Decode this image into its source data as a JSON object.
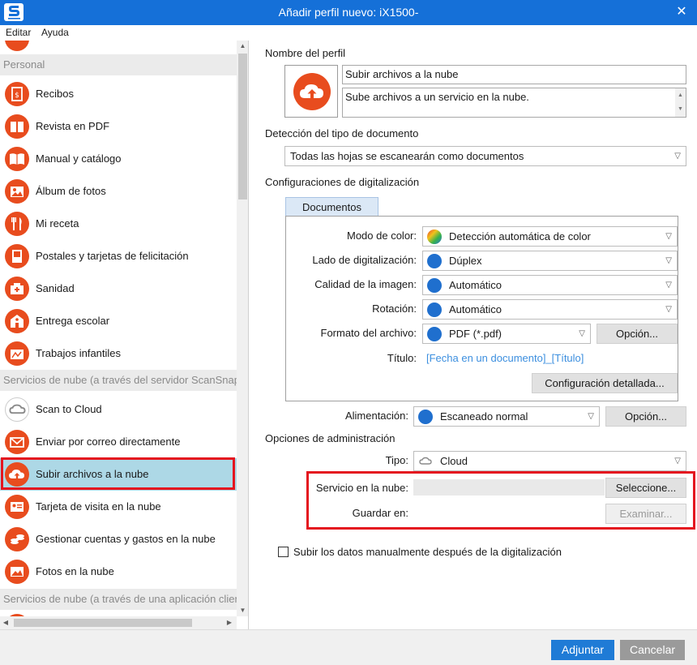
{
  "window": {
    "title": "Añadir perfil nuevo: iX1500-",
    "close_icon": "close-icon"
  },
  "menu": {
    "edit": "Editar",
    "help": "Ayuda"
  },
  "sidebar": {
    "cat_personal": "Personal",
    "cat_cloud_server": "Servicios de nube (a través del servidor ScanSnap Cloud)",
    "cat_cloud_app": "Servicios de nube (a través de una aplicación cliente)",
    "items": [
      {
        "label": "Recibos",
        "icon": "receipt-icon"
      },
      {
        "label": "Revista en PDF",
        "icon": "magazine-icon"
      },
      {
        "label": "Manual y catálogo",
        "icon": "book-icon"
      },
      {
        "label": "Álbum de fotos",
        "icon": "photo-album-icon"
      },
      {
        "label": "Mi receta",
        "icon": "cutlery-icon"
      },
      {
        "label": "Postales y tarjetas de felicitación",
        "icon": "postcard-icon"
      },
      {
        "label": "Sanidad",
        "icon": "medical-icon"
      },
      {
        "label": "Entrega escolar",
        "icon": "school-icon"
      },
      {
        "label": "Trabajos infantiles",
        "icon": "kids-art-icon"
      },
      {
        "label": "Scan to Cloud",
        "icon": "scansnap-cloud-icon"
      },
      {
        "label": "Enviar por correo directamente",
        "icon": "mail-icon"
      },
      {
        "label": "Subir archivos a la nube",
        "icon": "cloud-upload-icon"
      },
      {
        "label": "Tarjeta de visita en la nube",
        "icon": "business-card-icon"
      },
      {
        "label": "Gestionar cuentas y gastos en la nube",
        "icon": "coins-icon"
      },
      {
        "label": "Fotos en la nube",
        "icon": "photos-icon"
      }
    ]
  },
  "profile": {
    "name_label": "Nombre del perfil",
    "name_value": "Subir archivos a la nube",
    "description_value": "Sube archivos a un servicio en la nube."
  },
  "detection": {
    "label": "Detección del tipo de documento",
    "value": "Todas las hojas se escanearán como documentos"
  },
  "scan_settings": {
    "label": "Configuraciones de digitalización",
    "tab": "Documentos",
    "color_mode_label": "Modo de color:",
    "color_mode_value": "Detección automática de color",
    "side_label": "Lado de digitalización:",
    "side_value": "Dúplex",
    "quality_label": "Calidad de la imagen:",
    "quality_value": "Automático",
    "rotation_label": "Rotación:",
    "rotation_value": "Automático",
    "format_label": "Formato del archivo:",
    "format_value": "PDF (*.pdf)",
    "format_option_button": "Opción...",
    "title_label": "Título:",
    "title_value": "[Fecha en un documento]_[Título]",
    "detailed_button": "Configuración detallada...",
    "feed_label": "Alimentación:",
    "feed_value": "Escaneado normal",
    "feed_option_button": "Opción..."
  },
  "management": {
    "label": "Opciones de administración",
    "type_label": "Tipo:",
    "type_value": "Cloud",
    "service_label": "Servicio en la nube:",
    "select_button": "Seleccione...",
    "save_label": "Guardar en:",
    "browse_button": "Examinar..."
  },
  "manual_upload_checkbox": "Subir los datos manualmente después de la digitalización",
  "footer": {
    "add_button": "Adjuntar",
    "cancel_button": "Cancelar"
  }
}
